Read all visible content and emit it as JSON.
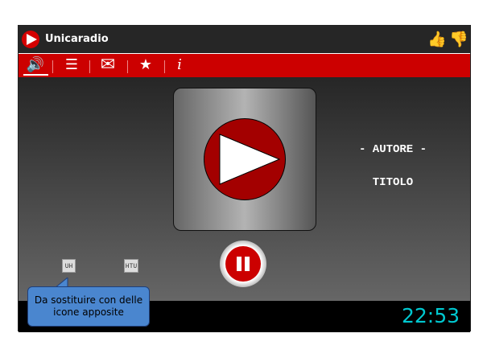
{
  "app": {
    "title": "Unicaradio"
  },
  "header": {
    "like_icon": "thumbs-up-icon",
    "dislike_icon": "thumbs-down-icon",
    "like": "👍",
    "dislike": "👎"
  },
  "nav": {
    "items": [
      {
        "icon": "speaker-icon",
        "glyph": "🔊",
        "active": true
      },
      {
        "icon": "list-icon",
        "glyph": "☰"
      },
      {
        "icon": "mail-icon",
        "glyph": "✉"
      },
      {
        "icon": "star-icon",
        "glyph": "★"
      },
      {
        "icon": "info-icon",
        "glyph": "i"
      }
    ]
  },
  "player": {
    "author": "- AUTORE -",
    "title": "TITOLO",
    "state": "playing"
  },
  "placeholders": [
    "UH",
    "HTU"
  ],
  "clock": "22:53",
  "callout": "Da sostituire con delle icone apposite",
  "colors": {
    "brand_red": "#cc0000",
    "clock": "#00c8d0",
    "callout": "#4a86cf"
  }
}
